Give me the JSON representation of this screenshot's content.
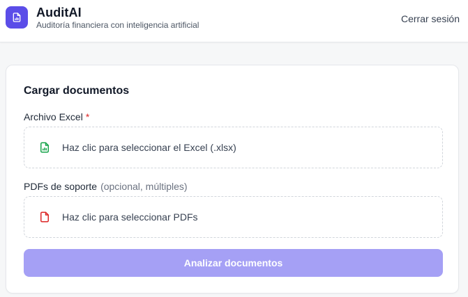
{
  "header": {
    "title": "AuditAI",
    "subtitle": "Auditoría financiera con inteligencia artificial",
    "logout_label": "Cerrar sesión",
    "logo_icon": "document-chart-icon"
  },
  "upload": {
    "title": "Cargar documentos",
    "excel": {
      "label": "Archivo Excel",
      "required_mark": "*",
      "prompt": "Haz clic para seleccionar el Excel (.xlsx)",
      "icon": "excel-file-icon",
      "icon_color": "#16a34a"
    },
    "pdfs": {
      "label": "PDFs de soporte",
      "note": "(opcional, múltiples)",
      "prompt": "Haz clic para seleccionar PDFs",
      "icon": "pdf-file-icon",
      "icon_color": "#dc2626"
    },
    "submit_label": "Analizar documentos"
  },
  "colors": {
    "accent": "#5b4de8",
    "button_disabled": "#a5a0f5"
  }
}
